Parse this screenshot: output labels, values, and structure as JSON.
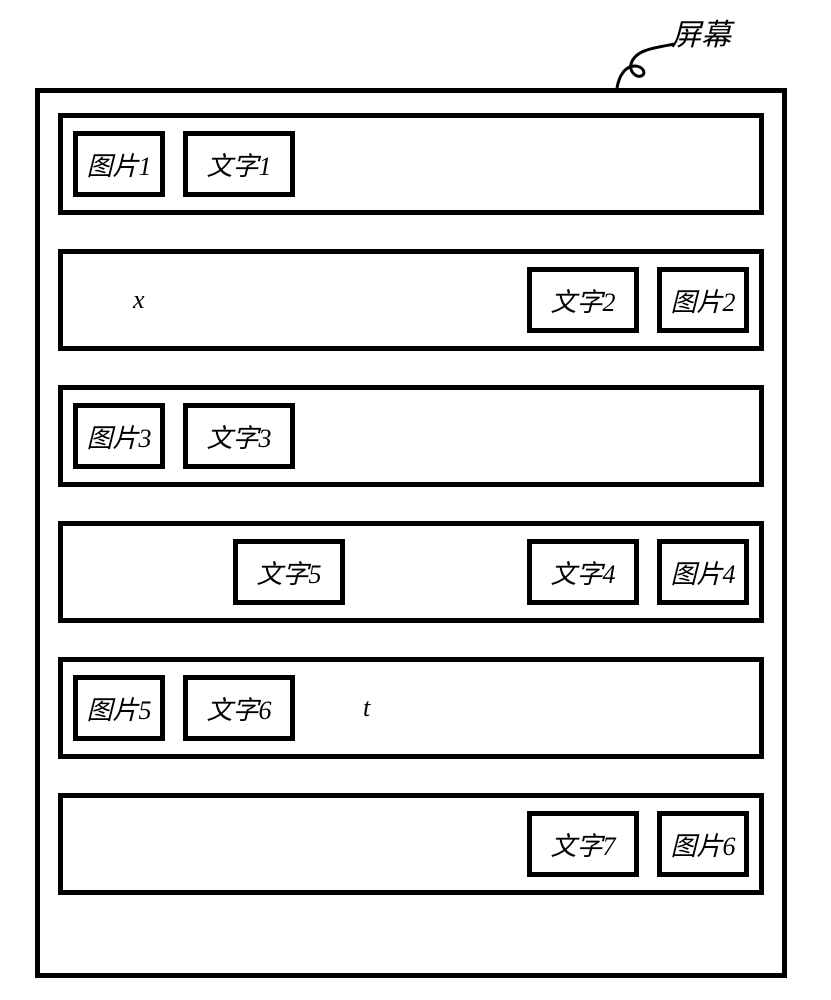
{
  "label": "屏幕",
  "rows": [
    {
      "align": "left",
      "cells": [
        {
          "kind": "img",
          "text": "图片1"
        },
        {
          "kind": "text",
          "text": "文字1"
        }
      ]
    },
    {
      "align": "right",
      "loose_left": "x",
      "cells": [
        {
          "kind": "text",
          "text": "文字2"
        },
        {
          "kind": "img",
          "text": "图片2"
        }
      ]
    },
    {
      "align": "left",
      "cells": [
        {
          "kind": "img",
          "text": "图片3"
        },
        {
          "kind": "text",
          "text": "文字3"
        }
      ]
    },
    {
      "align": "right",
      "mid_cell": {
        "text": "文字5"
      },
      "cells": [
        {
          "kind": "text",
          "text": "文字4"
        },
        {
          "kind": "img",
          "text": "图片4"
        }
      ]
    },
    {
      "align": "left",
      "loose_right": "t",
      "cells": [
        {
          "kind": "img",
          "text": "图片5"
        },
        {
          "kind": "text",
          "text": "文字6"
        }
      ]
    },
    {
      "align": "right",
      "cells": [
        {
          "kind": "text",
          "text": "文字7"
        },
        {
          "kind": "img",
          "text": "图片6"
        }
      ]
    }
  ]
}
